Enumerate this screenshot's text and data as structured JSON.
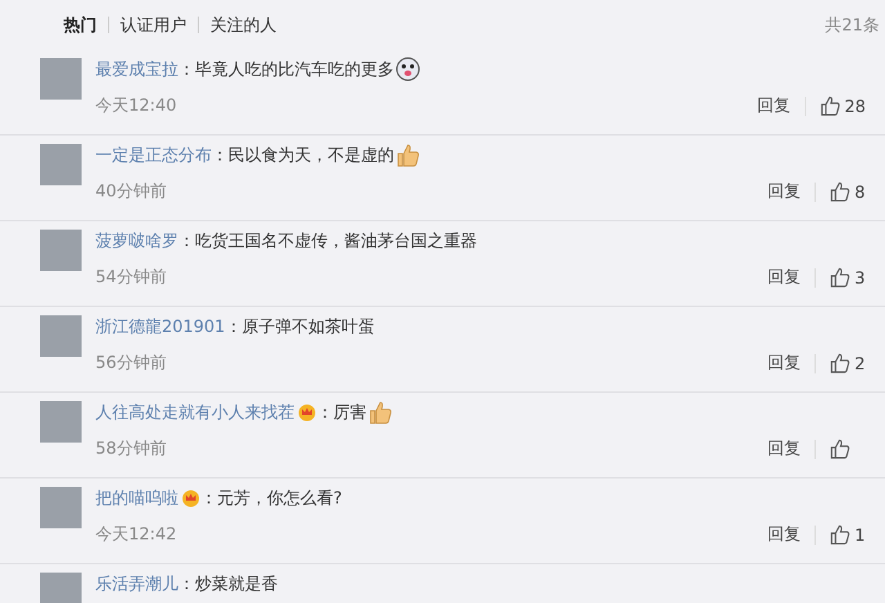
{
  "tabs": [
    {
      "label": "热门",
      "selected": true
    },
    {
      "label": "认证用户",
      "selected": false
    },
    {
      "label": "关注的人",
      "selected": false
    }
  ],
  "total": "共21条",
  "comments": [
    {
      "user": "最爱成宝拉",
      "badge": false,
      "text": "：毕竟人吃的比汽车吃的更多",
      "emoji": {
        "kind": "face"
      },
      "time": "今天12:40",
      "reply": "回复",
      "likes": "28"
    },
    {
      "user": "一定是正态分布",
      "badge": false,
      "text": "：民以食为天，不是虚的",
      "emoji": {
        "kind": "thumb"
      },
      "time": "40分钟前",
      "reply": "回复",
      "likes": "8"
    },
    {
      "user": "菠萝啵啥罗",
      "badge": false,
      "text": "：吃货王国名不虚传，酱油茅台国之重器",
      "time": "54分钟前",
      "reply": "回复",
      "likes": "3"
    },
    {
      "user": "浙江德龍201901",
      "badge": false,
      "text": "：原子弹不如茶叶蛋",
      "time": "56分钟前",
      "reply": "回复",
      "likes": "2"
    },
    {
      "user": "人往高处走就有小人来找茬",
      "badge": true,
      "text": "：厉害",
      "emoji": {
        "kind": "thumb"
      },
      "time": "58分钟前",
      "reply": "回复"
    },
    {
      "user": "把的喵呜啦",
      "badge": true,
      "text": "：元芳，你怎么看?",
      "time": "今天12:42",
      "reply": "回复",
      "likes": "1"
    },
    {
      "user": "乐活弄潮儿",
      "badge": false,
      "text": "：炒菜就是香"
    }
  ]
}
